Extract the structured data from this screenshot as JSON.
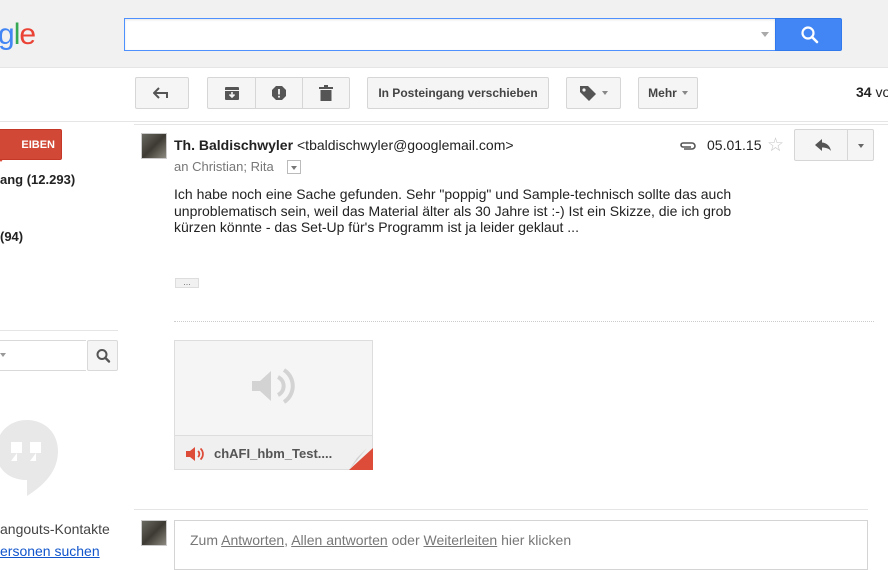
{
  "header": {
    "logo_partial": "gle",
    "search_value": ""
  },
  "toolbar": {
    "move_to_inbox_label": "In Posteingang verschieben",
    "more_label": "Mehr",
    "count_bold": "34",
    "count_rest": "vo"
  },
  "sidebar": {
    "compose_label": "EIBEN",
    "inbox_label": "ang (12.293)",
    "item2_label": "(94)",
    "hangouts_contacts": "angouts-Kontakte",
    "find_people": "ersonen suchen"
  },
  "message": {
    "sender_name": "Th. Baldischwyler",
    "sender_email": "<tbaldischwyler@googlemail.com>",
    "recipients": "an Christian; Rita",
    "date": "05.01.15",
    "body_line1": "Ich habe noch eine Sache gefunden. Sehr \"poppig\" und Sample-technisch sollte das auch",
    "body_line2": "unproblematisch sein, weil das Material älter als 30 Jahre ist :-) Ist ein Skizze, die ich grob",
    "body_line3": "kürzen könnte - das Set-Up für's Programm ist ja leider geklaut ...",
    "ellipsis": "...",
    "attachment_name": "chAFI_hbm_Test...."
  },
  "reply_box": {
    "prefix": "Zum ",
    "reply": "Antworten",
    "sep": ", ",
    "reply_all": "Allen antworten",
    "or": " oder ",
    "forward": "Weiterleiten",
    "suffix": " hier klicken"
  },
  "colors": {
    "search_blue": "#4285f4",
    "compose_red": "#d14836",
    "link_blue": "#15c"
  }
}
